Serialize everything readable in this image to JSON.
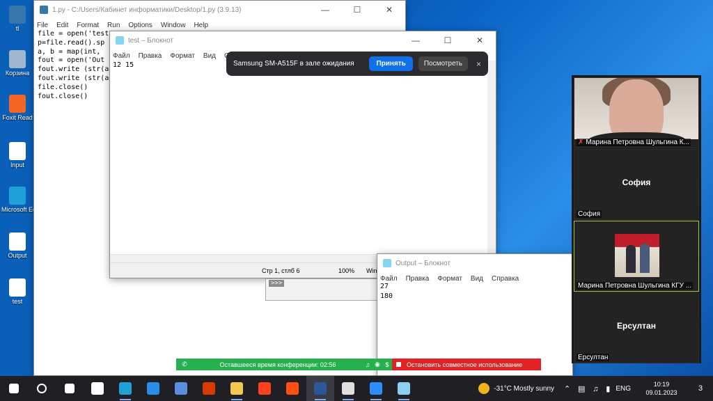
{
  "desktop": {
    "icons": [
      {
        "label": "tl",
        "icon": "python-file-icon",
        "color": "#3776ab"
      },
      {
        "label": "Корзина",
        "icon": "recycle-bin-icon",
        "color": "#9fb6cc"
      },
      {
        "label": "Foxit Read",
        "icon": "foxit-reader-icon",
        "color": "#f26522"
      },
      {
        "label": "Input",
        "icon": "text-file-icon",
        "color": "#ffffff"
      },
      {
        "label": "Microsoft Edge",
        "icon": "edge-icon",
        "color": "#1fa1d8"
      },
      {
        "label": "Output",
        "icon": "text-file-icon",
        "color": "#ffffff"
      },
      {
        "label": "test",
        "icon": "text-file-icon",
        "color": "#ffffff"
      }
    ]
  },
  "idle": {
    "title": "1.py - C:/Users/Кабинет информатики/Desktop/1.py (3.9.13)",
    "menu": [
      "File",
      "Edit",
      "Format",
      "Run",
      "Options",
      "Window",
      "Help"
    ],
    "code_lines": [
      "file = open('test",
      "p=file.read().sp",
      "a, b = map(int, ",
      "fout = open('Out",
      "fout.write (str(a",
      "fout.write (str(a",
      "file.close()",
      "fout.close()"
    ]
  },
  "notepad_test": {
    "title": "test – Блокнот",
    "menu": [
      "Файл",
      "Правка",
      "Формат",
      "Вид",
      "Справка"
    ],
    "content": "12 15",
    "status": {
      "position": "Стр 1, стлб 6",
      "zoom": "100%",
      "encoding": "Win"
    }
  },
  "shell": {
    "prompt": ">>>"
  },
  "notepad_output": {
    "title": "Output – Блокнот",
    "menu": [
      "Файл",
      "Правка",
      "Формат",
      "Вид",
      "Справка"
    ],
    "content": "27\n180"
  },
  "toast": {
    "message": "Samsung SM-A515F в зале ожидания",
    "accept_label": "Принять",
    "view_label": "Посмотреть",
    "close_label": "×"
  },
  "participants": [
    {
      "name": "Марина Петровна Шульгина  К...",
      "type": "video",
      "muted": true
    },
    {
      "name": "София",
      "type": "name",
      "big_name": "София"
    },
    {
      "name": "Марина Петровна Шульгина  КГУ ...",
      "type": "photo",
      "active": true
    },
    {
      "name": "Ерсултан",
      "type": "name",
      "big_name": "Ерсултан"
    }
  ],
  "meeting": {
    "remaining": "Оставшееся время конференции: 02:56",
    "stop_share": "Остановить совместное использование"
  },
  "taskbar": {
    "apps": [
      {
        "name": "start",
        "icon": "windows-start-icon",
        "color": "#ffffff"
      },
      {
        "name": "search",
        "icon": "search-icon",
        "color": "#ffffff"
      },
      {
        "name": "task-view",
        "icon": "task-view-icon",
        "color": "#ffffff"
      },
      {
        "name": "widgets",
        "icon": "widgets-icon",
        "color": "#ffffff"
      },
      {
        "name": "edge",
        "icon": "edge-icon",
        "color": "#1fa1d8"
      },
      {
        "name": "mail",
        "icon": "mail-icon",
        "color": "#2a8ee8"
      },
      {
        "name": "store",
        "icon": "store-icon",
        "color": "#5a8fe0"
      },
      {
        "name": "office",
        "icon": "office-icon",
        "color": "#d83b01"
      },
      {
        "name": "explorer",
        "icon": "folder-icon",
        "color": "#f2c94c"
      },
      {
        "name": "yandex",
        "icon": "yandex-icon",
        "color": "#fc3f1d"
      },
      {
        "name": "aliexpress",
        "icon": "aliexpress-icon",
        "color": "#ff4f14"
      },
      {
        "name": "word",
        "icon": "word-icon",
        "color": "#2b579a"
      },
      {
        "name": "python",
        "icon": "python-icon",
        "color": "#e0e0e0"
      },
      {
        "name": "zoom",
        "icon": "zoom-icon",
        "color": "#2d8cff"
      },
      {
        "name": "notepad",
        "icon": "notepad-icon",
        "color": "#8ad0f0"
      }
    ],
    "weather": "-31°C  Mostly sunny",
    "lang": "ENG",
    "time": "10:19",
    "date": "09.01.2023",
    "notifications": "3"
  }
}
